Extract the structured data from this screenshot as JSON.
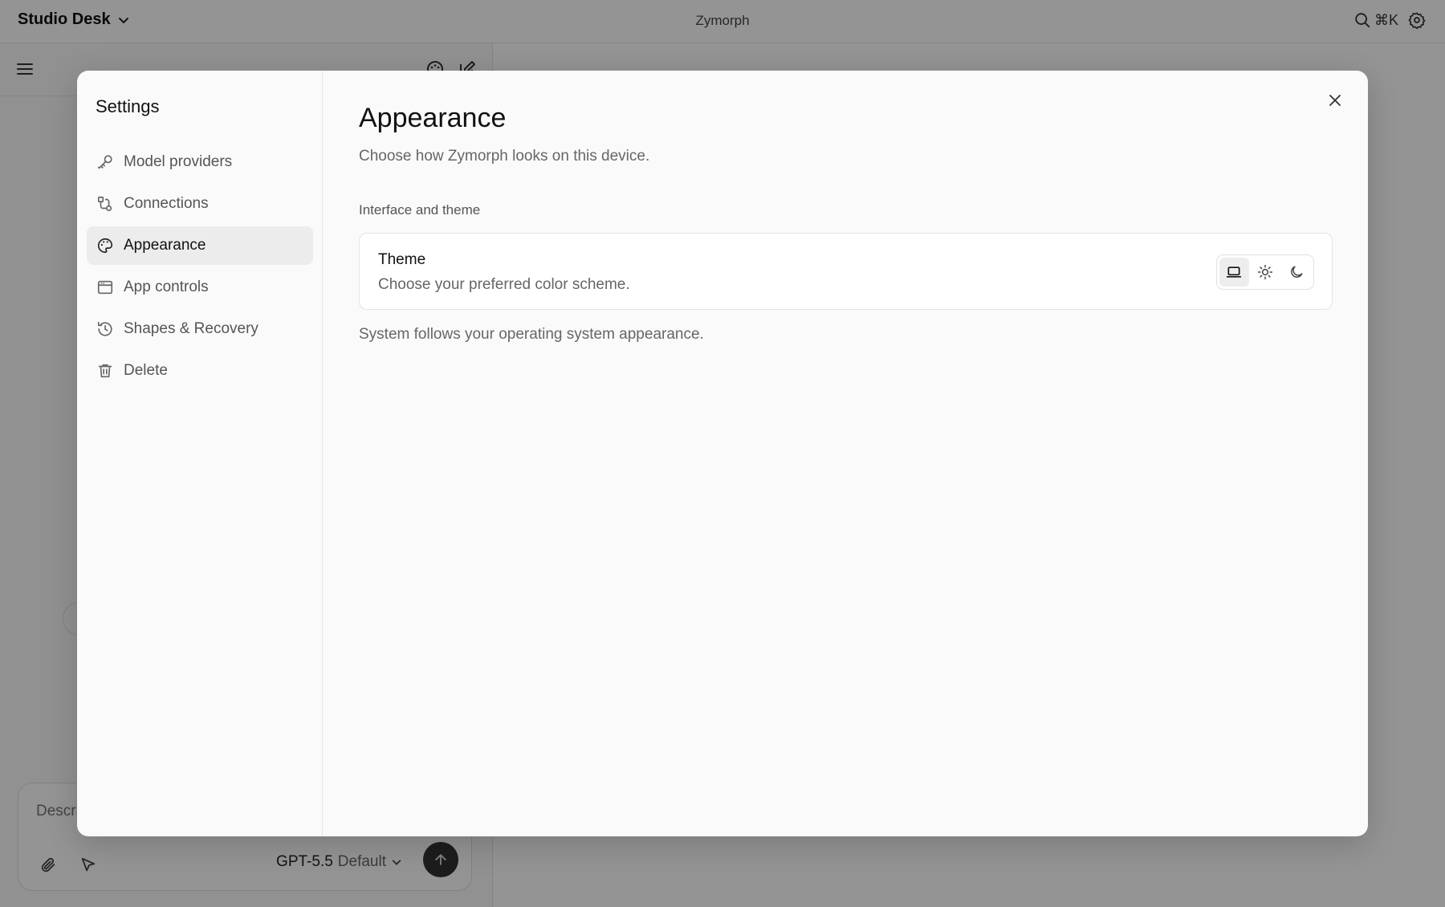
{
  "topbar": {
    "workspace_name": "Studio Desk",
    "app_title": "Zymorph",
    "search_shortcut": "⌘K"
  },
  "composer": {
    "placeholder": "Describe",
    "model_name": "GPT-5.5",
    "model_variant": "Default"
  },
  "settings": {
    "title": "Settings",
    "nav": [
      {
        "label": "Model providers",
        "icon": "key-icon",
        "active": false
      },
      {
        "label": "Connections",
        "icon": "connections-icon",
        "active": false
      },
      {
        "label": "Appearance",
        "icon": "palette-icon",
        "active": true
      },
      {
        "label": "App controls",
        "icon": "window-icon",
        "active": false
      },
      {
        "label": "Shapes & Recovery",
        "icon": "history-icon",
        "active": false
      },
      {
        "label": "Delete",
        "icon": "trash-icon",
        "active": false
      }
    ],
    "page": {
      "title": "Appearance",
      "subtitle": "Choose how Zymorph looks on this device.",
      "section_label": "Interface and theme",
      "theme_title": "Theme",
      "theme_description": "Choose your preferred color scheme.",
      "theme_options": [
        "system",
        "light",
        "dark"
      ],
      "theme_selected": "system",
      "footnote": "System follows your operating system appearance."
    }
  },
  "colors": {
    "overlay": "#6b6b6b",
    "modal_bg": "#fafafa",
    "active_nav_bg": "#ececec",
    "send_button": "#333333"
  }
}
